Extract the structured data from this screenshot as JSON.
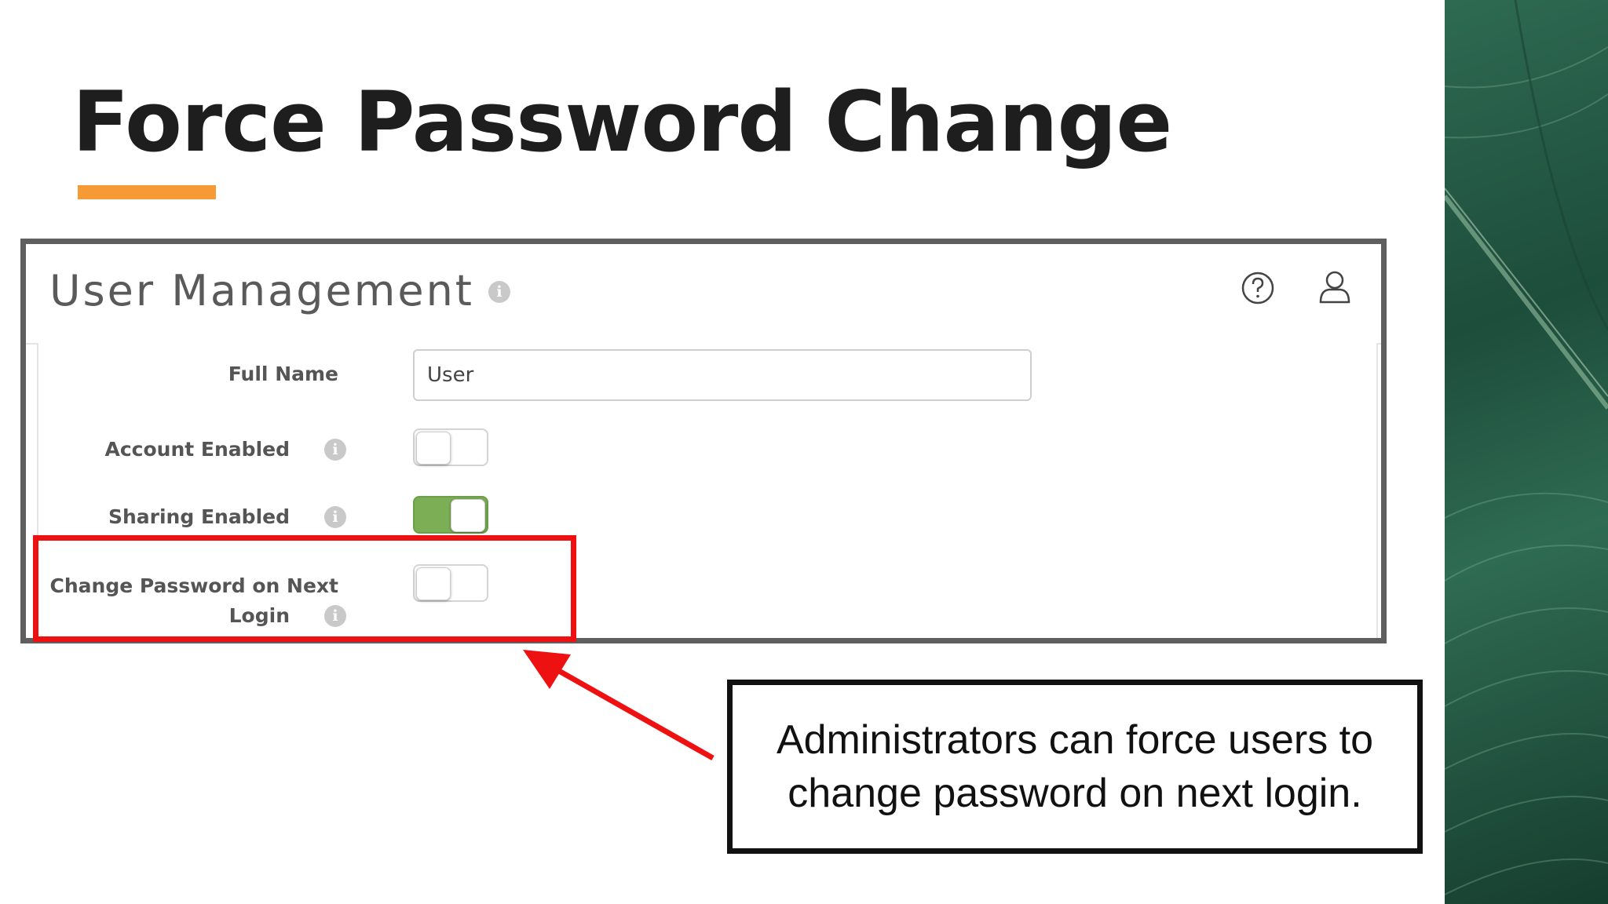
{
  "slide": {
    "title": "Force Password Change",
    "accent_color": "#f59a35"
  },
  "app": {
    "title": "User Management",
    "title_info_icon": "info-icon",
    "header_icons": [
      "help-icon",
      "user-icon"
    ],
    "fields": {
      "full_name": {
        "label": "Full Name",
        "value": "User"
      },
      "account_enabled": {
        "label": "Account Enabled",
        "state": "off"
      },
      "sharing_enabled": {
        "label": "Sharing Enabled",
        "state": "on",
        "on_color": "#7cae55"
      },
      "change_password": {
        "label_line1": "Change Password on Next",
        "label_line2": "Login",
        "state": "off"
      }
    }
  },
  "annotation": {
    "highlight_color": "#ee1111",
    "callout_line1": "Administrators can force users to",
    "callout_line2": "change password on next login."
  }
}
